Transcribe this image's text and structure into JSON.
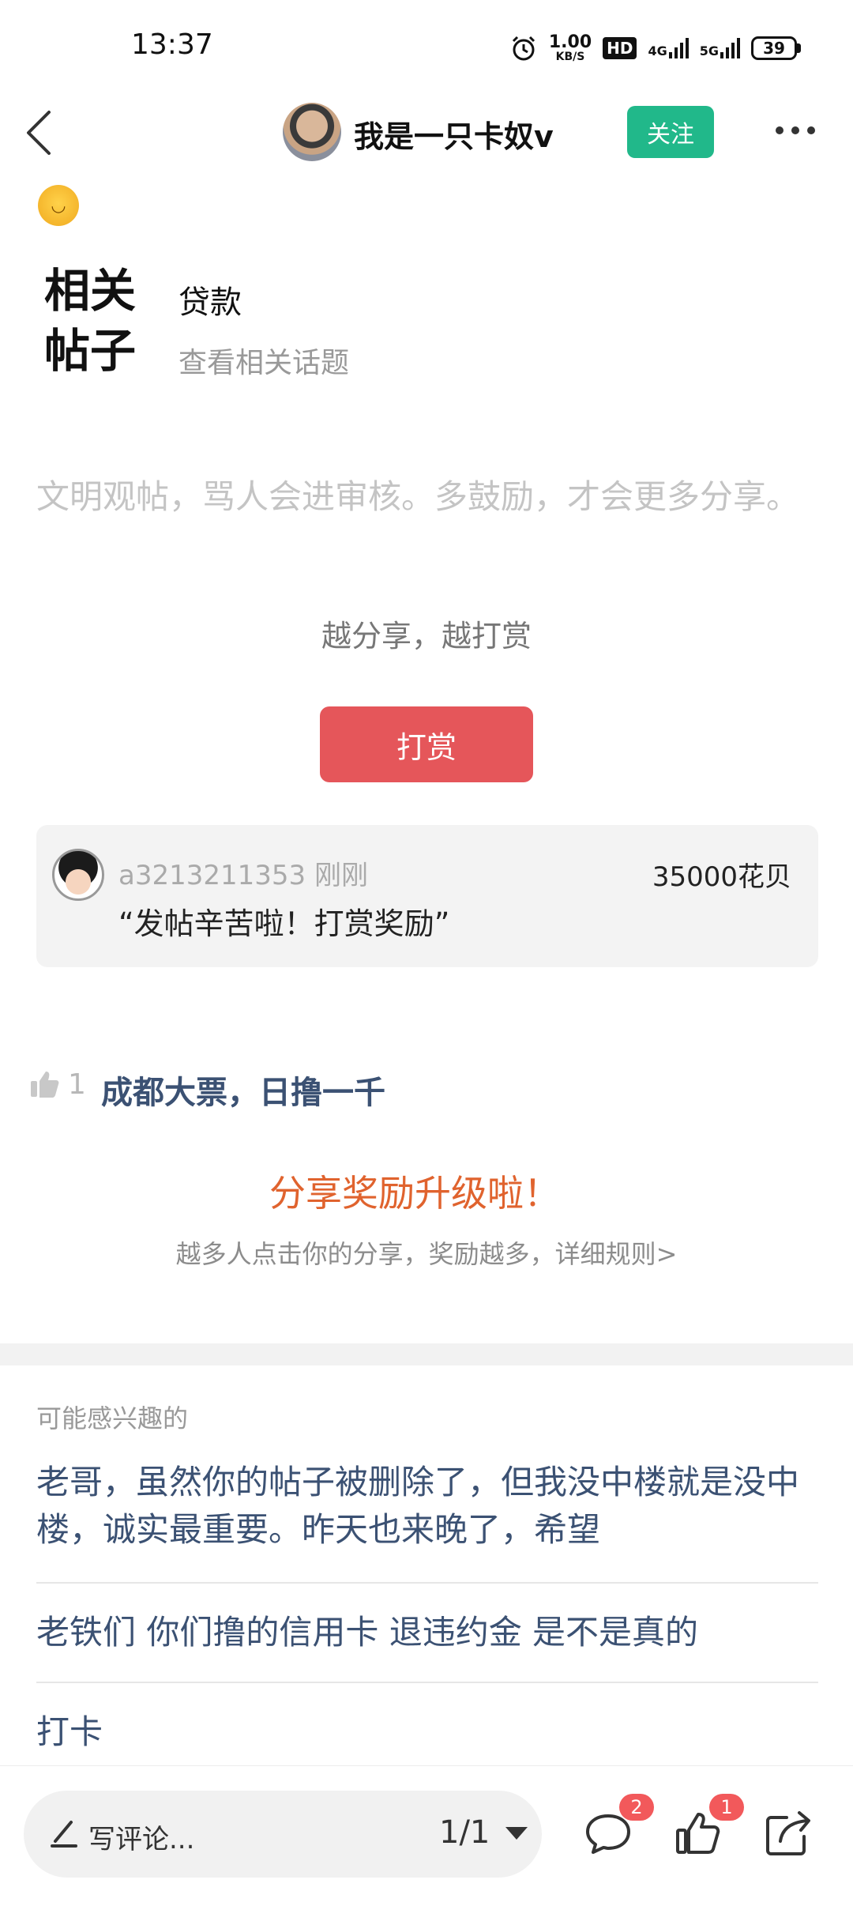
{
  "status_bar": {
    "time": "13:37",
    "net_speed_value": "1.00",
    "net_speed_unit": "KB/S",
    "hd_label": "HD",
    "network_1": "4G",
    "network_2": "5G",
    "battery": "39"
  },
  "header": {
    "author_name": "我是一只卡奴v",
    "follow_label": "关注"
  },
  "related": {
    "title": "相关帖子",
    "tag": "贷款",
    "link": "查看相关话题"
  },
  "comment_hint": "文明观帖，骂人会进审核。多鼓励，才会更多分享。",
  "reward": {
    "share_more_text": "越分享，越打赏",
    "tip_button": "打赏",
    "tipper_name": "a3213211353",
    "tip_time": "刚刚",
    "tip_amount": "35000花贝",
    "tip_message": "“发帖辛苦啦！打赏奖励”"
  },
  "like_row": {
    "count": "1",
    "title": "成都大票，日撸一千"
  },
  "share_upgrade": {
    "title": "分享奖励升级啦！",
    "subtitle": "越多人点击你的分享，奖励越多，详细规则>"
  },
  "interest": {
    "label": "可能感兴趣的",
    "items": [
      "老哥，虽然你的帖子被删除了，但我没中楼就是没中楼，诚实最重要。昨天也来晚了，希望",
      "老铁们 你们撸的信用卡 退违约金 是不是真的",
      "打卡"
    ]
  },
  "bottom_bar": {
    "comment_placeholder": "写评论...",
    "page_indicator": "1/1",
    "comment_badge": "2",
    "like_badge": "1"
  },
  "colors": {
    "follow_green": "#21b88a",
    "tip_red": "#e5565a",
    "link_blue": "#3b5173",
    "upgrade_orange": "#e0632e"
  }
}
